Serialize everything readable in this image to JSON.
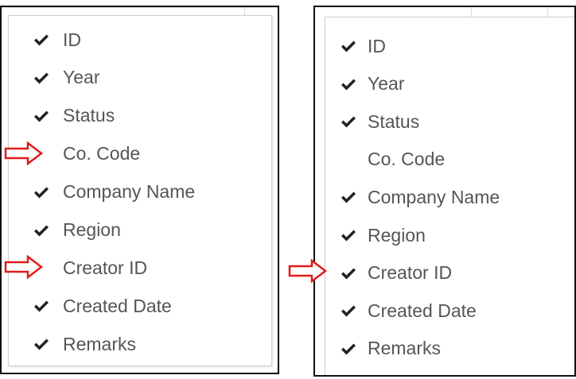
{
  "panels": [
    {
      "items": [
        {
          "label": "ID",
          "checked": true
        },
        {
          "label": "Year",
          "checked": true
        },
        {
          "label": "Status",
          "checked": true
        },
        {
          "label": "Co. Code",
          "checked": false,
          "arrow": true
        },
        {
          "label": "Company Name",
          "checked": true
        },
        {
          "label": "Region",
          "checked": true
        },
        {
          "label": "Creator ID",
          "checked": false,
          "arrow": true
        },
        {
          "label": "Created Date",
          "checked": true
        },
        {
          "label": "Remarks",
          "checked": true
        }
      ]
    },
    {
      "items": [
        {
          "label": "ID",
          "checked": true
        },
        {
          "label": "Year",
          "checked": true
        },
        {
          "label": "Status",
          "checked": true
        },
        {
          "label": "Co. Code",
          "checked": false
        },
        {
          "label": "Company Name",
          "checked": true
        },
        {
          "label": "Region",
          "checked": true
        },
        {
          "label": "Creator ID",
          "checked": true,
          "arrow": true
        },
        {
          "label": "Created Date",
          "checked": true
        },
        {
          "label": "Remarks",
          "checked": true
        }
      ]
    }
  ],
  "colors": {
    "text": "#555555",
    "check": "#222222",
    "arrow": "#e01b1b",
    "frame": "#111111"
  },
  "icons": {
    "check": "check-icon",
    "arrow": "arrow-right-outline-icon"
  }
}
